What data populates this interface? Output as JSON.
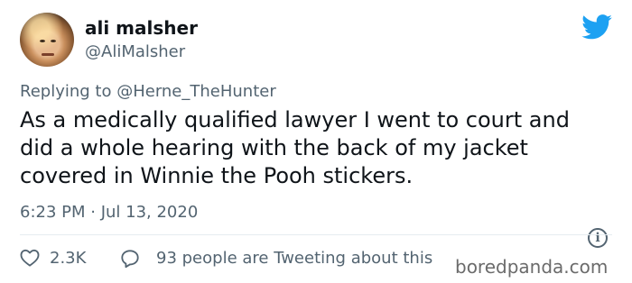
{
  "tweet": {
    "display_name": "ali malsher",
    "handle": "@AliMalsher",
    "reply_prefix": "Replying to ",
    "reply_to": "@Herne_TheHunter",
    "text_lines": [
      "As a medically qualified lawyer I went to court and",
      "did a whole hearing with the back of my jacket",
      "covered in Winnie the Pooh stickers."
    ],
    "timestamp": "6:23 PM · Jul 13, 2020",
    "like_count": "2.3K",
    "tweeting_text": "93 people are Tweeting about this",
    "info_glyph": "i"
  },
  "watermark": "boredpanda.com",
  "icons": {
    "brand": "twitter-bird-icon",
    "like": "heart-icon",
    "reply": "speech-bubble-icon",
    "info": "info-icon"
  },
  "colors": {
    "brand_blue": "#1da1f2",
    "text_primary": "#0f1419",
    "text_secondary": "#536471"
  }
}
